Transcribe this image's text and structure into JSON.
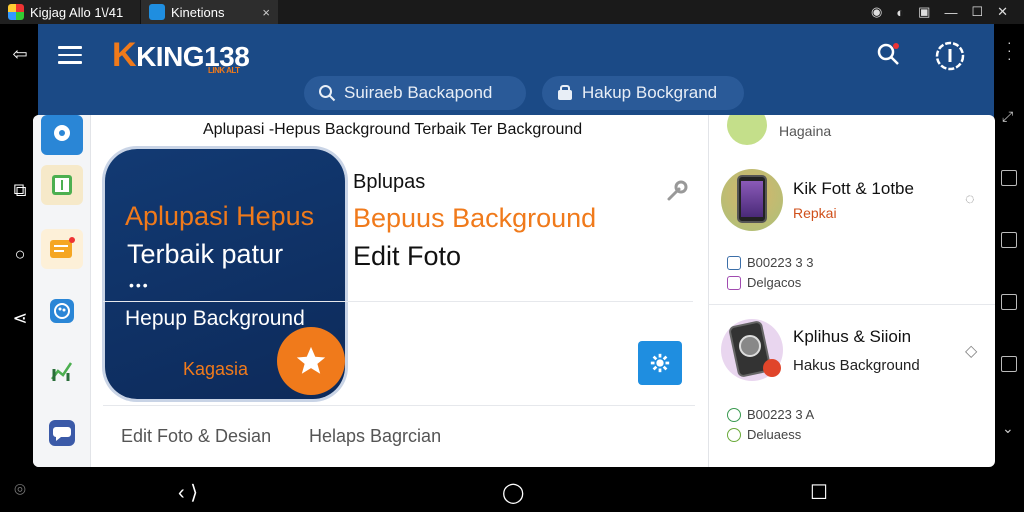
{
  "window": {
    "tab1_title": "Kigjag Allo 1\\/41",
    "tab2_title": "Kinetions",
    "tab2_close": "×"
  },
  "colors": {
    "header": "#1b4a86",
    "accent": "#f07a1b",
    "share": "#1f8ee0"
  },
  "header": {
    "logo_k": "K",
    "logo_text": "KING138",
    "logo_sub": "LINK ALT",
    "pill1_label": "Suiraeb Backapond",
    "pill2_label": "Hakup Bockgrand"
  },
  "main": {
    "title": "Aplupasi -Hepus Background Terbaik Ter Background",
    "hero": {
      "line1": "Aplupasi Hepus",
      "line2": "Terbaik patur",
      "dots": "•••",
      "line3": "Hepup Background",
      "line4": "Kagasia"
    },
    "info_title": "Bplupas",
    "info_name": "Bepuus Background",
    "info_category": "Edit Foto",
    "bottom_left": "Edit Foto & Desian",
    "bottom_right": "Helaps Bagrcian"
  },
  "right_panel": {
    "top_label": "Hagaina",
    "card1": {
      "title": "Kik Fott & 1otbe",
      "subtitle": "Repkai",
      "meta1": "B00223 3 3",
      "meta2": "Delgacos"
    },
    "card2": {
      "title": "Kplihus & Siioin",
      "subtitle": "Hakus Background",
      "meta1": "B00223 3 A",
      "meta2": "Deluaess"
    }
  },
  "icons": [
    "hamburger-icon",
    "search-icon",
    "info-icon",
    "star-icon",
    "share-icon",
    "wrench-icon"
  ]
}
